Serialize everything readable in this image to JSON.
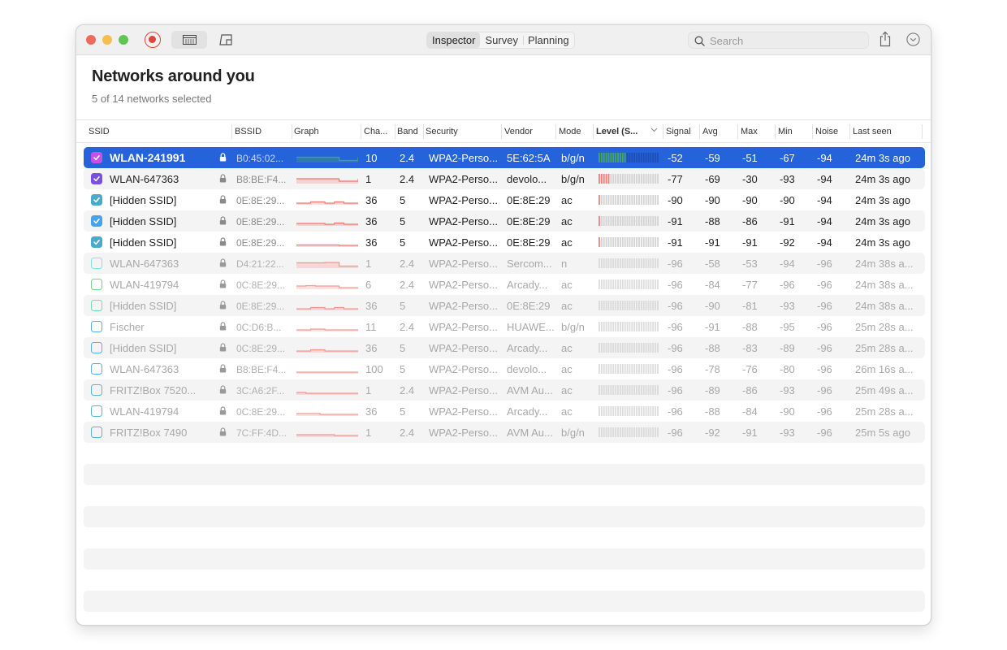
{
  "window": {
    "toolbar": {
      "segments": [
        "Inspector",
        "Survey",
        "Planning"
      ],
      "active_segment": "Inspector",
      "search_placeholder": "Search",
      "icons": {
        "record": "record-icon",
        "table_view": "table-view-icon",
        "plan_view": "floor-plan-icon",
        "search": "magnifier-icon",
        "share": "share-icon",
        "more": "chevron-down-circle-icon"
      }
    },
    "header": {
      "title": "Networks around you",
      "subtitle": "5 of 14 networks selected"
    },
    "columns": {
      "ssid": "SSID",
      "bssid": "BSSID",
      "graph": "Graph",
      "channel": "Cha...",
      "band": "Band",
      "security": "Security",
      "vendor": "Vendor",
      "mode": "Mode",
      "level": "Level (S...",
      "signal": "Signal",
      "avg": "Avg",
      "max": "Max",
      "min": "Min",
      "noise": "Noise",
      "last_seen": "Last seen"
    },
    "sort_column": "level",
    "colors": {
      "selection": "#2463d9",
      "signal_good": "#4caf50",
      "signal_bad": "#f26b63"
    },
    "networks": [
      {
        "checked": true,
        "color": "#c452e8",
        "ssid": "WLAN-241991",
        "bssid": "B0:45:02...",
        "channel": "10",
        "band": "2.4",
        "security": "WPA2-Perso...",
        "vendor": "5E:62:5A",
        "mode": "b/g/n",
        "level": 0.48,
        "signal": "-52",
        "avg": "-59",
        "max": "-51",
        "min": "-67",
        "noise": "-94",
        "last_seen": "24m 3s ago",
        "selected": true,
        "graph": [
          0.55,
          0.55,
          0.55,
          0.55,
          0.55,
          0.55,
          0.55,
          0.55,
          0.55,
          0.15,
          0.15,
          0.15,
          0.15,
          0.55
        ]
      },
      {
        "checked": true,
        "color": "#7b4fe0",
        "ssid": "WLAN-647363",
        "bssid": "B8:BE:F4...",
        "channel": "1",
        "band": "2.4",
        "security": "WPA2-Perso...",
        "vendor": "devolo...",
        "mode": "b/g/n",
        "level": 0.2,
        "signal": "-77",
        "avg": "-69",
        "max": "-30",
        "min": "-93",
        "noise": "-94",
        "last_seen": "24m 3s ago",
        "graph": [
          0.5,
          0.5,
          0.5,
          0.5,
          0.5,
          0.5,
          0.5,
          0.5,
          0.5,
          0.2,
          0.2,
          0.2,
          0.2,
          0.5
        ]
      },
      {
        "checked": true,
        "color": "#4aaac9",
        "ssid": "[Hidden SSID]",
        "bssid": "0E:8E:29...",
        "channel": "36",
        "band": "5",
        "security": "WPA2-Perso...",
        "vendor": "0E:8E:29",
        "mode": "ac",
        "level": 0.04,
        "signal": "-90",
        "avg": "-90",
        "max": "-90",
        "min": "-90",
        "noise": "-94",
        "last_seen": "24m 3s ago",
        "graph": [
          0.1,
          0.1,
          0.1,
          0.25,
          0.25,
          0.25,
          0.1,
          0.1,
          0.25,
          0.25,
          0.1,
          0.1,
          0.1,
          0.1
        ]
      },
      {
        "checked": true,
        "color": "#4aa3e8",
        "ssid": "[Hidden SSID]",
        "bssid": "0E:8E:29...",
        "channel": "36",
        "band": "5",
        "security": "WPA2-Perso...",
        "vendor": "0E:8E:29",
        "mode": "ac",
        "level": 0.04,
        "signal": "-91",
        "avg": "-88",
        "max": "-86",
        "min": "-91",
        "noise": "-94",
        "last_seen": "24m 3s ago",
        "graph": [
          0.2,
          0.2,
          0.2,
          0.2,
          0.2,
          0.2,
          0.1,
          0.1,
          0.25,
          0.25,
          0.1,
          0.1,
          0.1,
          0.1
        ]
      },
      {
        "checked": true,
        "color": "#4aaac9",
        "ssid": "[Hidden SSID]",
        "bssid": "0E:8E:29...",
        "channel": "36",
        "band": "5",
        "security": "WPA2-Perso...",
        "vendor": "0E:8E:29",
        "mode": "ac",
        "level": 0.04,
        "signal": "-91",
        "avg": "-91",
        "max": "-91",
        "min": "-92",
        "noise": "-94",
        "last_seen": "24m 3s ago",
        "graph": [
          0.15,
          0.15,
          0.15,
          0.15,
          0.15,
          0.15,
          0.15,
          0.15,
          0.15,
          0.1,
          0.1,
          0.1,
          0.1,
          0.1
        ]
      },
      {
        "checked": false,
        "color": "#7fe3ee",
        "ssid": "WLAN-647363",
        "bssid": "D4:21:22...",
        "channel": "1",
        "band": "2.4",
        "security": "WPA2-Perso...",
        "vendor": "Sercom...",
        "mode": "n",
        "level": 0,
        "signal": "-96",
        "avg": "-58",
        "max": "-53",
        "min": "-94",
        "noise": "-96",
        "last_seen": "24m 38s a...",
        "graph": [
          0.55,
          0.55,
          0.55,
          0.55,
          0.55,
          0.55,
          0.6,
          0.6,
          0.6,
          0.15,
          0.15,
          0.15,
          0.15,
          0.15
        ]
      },
      {
        "checked": false,
        "color": "#72d68a",
        "ssid": "WLAN-419794",
        "bssid": "0C:8E:29...",
        "channel": "6",
        "band": "2.4",
        "security": "WPA2-Perso...",
        "vendor": "Arcady...",
        "mode": "ac",
        "level": 0,
        "signal": "-96",
        "avg": "-84",
        "max": "-77",
        "min": "-96",
        "noise": "-96",
        "last_seen": "24m 38s a...",
        "graph": [
          0.3,
          0.3,
          0.35,
          0.35,
          0.3,
          0.3,
          0.3,
          0.3,
          0.3,
          0.1,
          0.1,
          0.1,
          0.1,
          0.1
        ]
      },
      {
        "checked": false,
        "color": "#6fddb5",
        "ssid": "[Hidden SSID]",
        "bssid": "0E:8E:29...",
        "channel": "36",
        "band": "5",
        "security": "WPA2-Perso...",
        "vendor": "0E:8E:29",
        "mode": "ac",
        "level": 0,
        "signal": "-96",
        "avg": "-90",
        "max": "-81",
        "min": "-93",
        "noise": "-96",
        "last_seen": "24m 38s a...",
        "graph": [
          0.1,
          0.1,
          0.1,
          0.25,
          0.25,
          0.25,
          0.1,
          0.1,
          0.25,
          0.25,
          0.1,
          0.1,
          0.1,
          0.1
        ]
      },
      {
        "checked": false,
        "color": "#5aaee8",
        "ssid": "Fischer",
        "bssid": "0C:D6:B...",
        "channel": "11",
        "band": "2.4",
        "security": "WPA2-Perso...",
        "vendor": "HUAWE...",
        "mode": "b/g/n",
        "level": 0,
        "signal": "-96",
        "avg": "-91",
        "max": "-88",
        "min": "-95",
        "noise": "-96",
        "last_seen": "25m 28s a...",
        "graph": [
          0.1,
          0.1,
          0.1,
          0.2,
          0.2,
          0.2,
          0.1,
          0.1,
          0.1,
          0.1,
          0.1,
          0.1,
          0.1,
          0.1
        ]
      },
      {
        "checked": false,
        "color": "#5aaee8",
        "ssid": "[Hidden SSID]",
        "bssid": "0C:8E:29...",
        "channel": "36",
        "band": "5",
        "security": "WPA2-Perso...",
        "vendor": "Arcady...",
        "mode": "ac",
        "level": 0,
        "signal": "-96",
        "avg": "-88",
        "max": "-83",
        "min": "-89",
        "noise": "-96",
        "last_seen": "25m 28s a...",
        "graph": [
          0.1,
          0.1,
          0.1,
          0.25,
          0.25,
          0.25,
          0.1,
          0.1,
          0.1,
          0.1,
          0.1,
          0.1,
          0.1,
          0.1
        ]
      },
      {
        "checked": false,
        "color": "#5aaee8",
        "ssid": "WLAN-647363",
        "bssid": "B8:BE:F4...",
        "channel": "100",
        "band": "5",
        "security": "WPA2-Perso...",
        "vendor": "devolo...",
        "mode": "ac",
        "level": 0,
        "signal": "-96",
        "avg": "-78",
        "max": "-76",
        "min": "-80",
        "noise": "-96",
        "last_seen": "26m 16s a...",
        "graph": [
          0.1,
          0.1,
          0.1,
          0.1,
          0.1,
          0.1,
          0.1,
          0.1,
          0.1,
          0.1,
          0.1,
          0.1,
          0.1,
          0.1
        ]
      },
      {
        "checked": false,
        "color": "#5ab4d4",
        "ssid": "FRITZ!Box 7520...",
        "bssid": "3C:A6:2F...",
        "channel": "1",
        "band": "2.4",
        "security": "WPA2-Perso...",
        "vendor": "AVM Au...",
        "mode": "ac",
        "level": 0,
        "signal": "-96",
        "avg": "-89",
        "max": "-86",
        "min": "-93",
        "noise": "-96",
        "last_seen": "25m 49s a...",
        "graph": [
          0.2,
          0.2,
          0.1,
          0.1,
          0.1,
          0.1,
          0.1,
          0.1,
          0.1,
          0.1,
          0.1,
          0.1,
          0.1,
          0.1
        ]
      },
      {
        "checked": false,
        "color": "#5ab4d4",
        "ssid": "WLAN-419794",
        "bssid": "0C:8E:29...",
        "channel": "36",
        "band": "5",
        "security": "WPA2-Perso...",
        "vendor": "Arcady...",
        "mode": "ac",
        "level": 0,
        "signal": "-96",
        "avg": "-88",
        "max": "-84",
        "min": "-90",
        "noise": "-96",
        "last_seen": "25m 28s a...",
        "graph": [
          0.2,
          0.2,
          0.2,
          0.2,
          0.2,
          0.1,
          0.1,
          0.1,
          0.1,
          0.1,
          0.1,
          0.1,
          0.1,
          0.1
        ]
      },
      {
        "checked": false,
        "color": "#5ab4d4",
        "ssid": "FRITZ!Box 7490",
        "bssid": "7C:FF:4D...",
        "channel": "1",
        "band": "2.4",
        "security": "WPA2-Perso...",
        "vendor": "AVM Au...",
        "mode": "b/g/n",
        "level": 0,
        "signal": "-96",
        "avg": "-92",
        "max": "-91",
        "min": "-93",
        "noise": "-96",
        "last_seen": "25m 5s ago",
        "graph": [
          0.2,
          0.2,
          0.2,
          0.2,
          0.2,
          0.2,
          0.2,
          0.2,
          0.1,
          0.1,
          0.1,
          0.1,
          0.1,
          0.1
        ]
      }
    ]
  }
}
